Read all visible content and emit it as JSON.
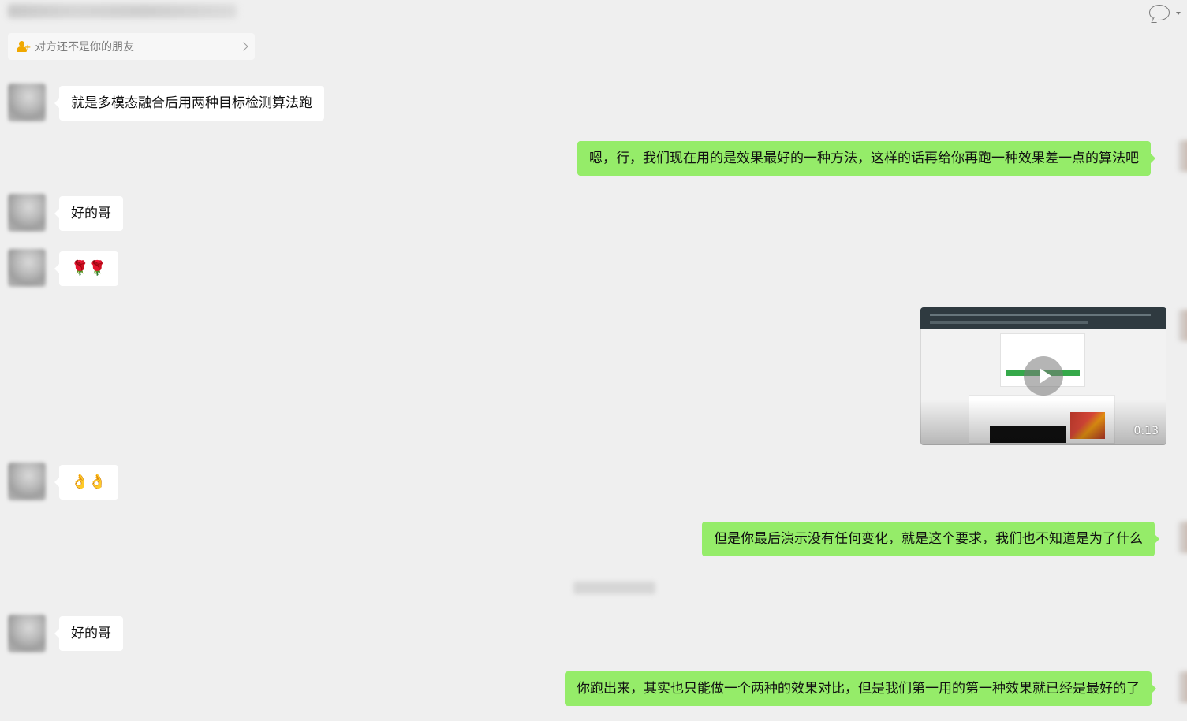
{
  "header": {
    "chat_title": "",
    "title_blurred": true
  },
  "banner": {
    "text": "对方还不是你的朋友"
  },
  "messages": {
    "m1": "就是多模态融合后用两种目标检测算法跑",
    "m2": "嗯，行，我们现在用的是效果最好的一种方法，这样的话再给你再跑一种效果差一点的算法吧",
    "m3": "好的哥",
    "m4": "🌹🌹",
    "m5_video_duration": "0:13",
    "m6": "👌👌",
    "m7": "但是你最后演示没有任何变化，就是这个要求，我们也不知道是为了什么",
    "m8": "好的哥",
    "m9": "你跑出来，其实也只能做一个两种的效果对比，但是我们第一用的第一种效果就已经是最好的了"
  },
  "colors": {
    "background": "#efefef",
    "bubble_left": "#ffffff",
    "bubble_right": "#95ec69",
    "banner_icon": "#f0a800"
  },
  "icons": {
    "top_right": "chat-bubble-icon",
    "banner": "add-friend-icon"
  }
}
